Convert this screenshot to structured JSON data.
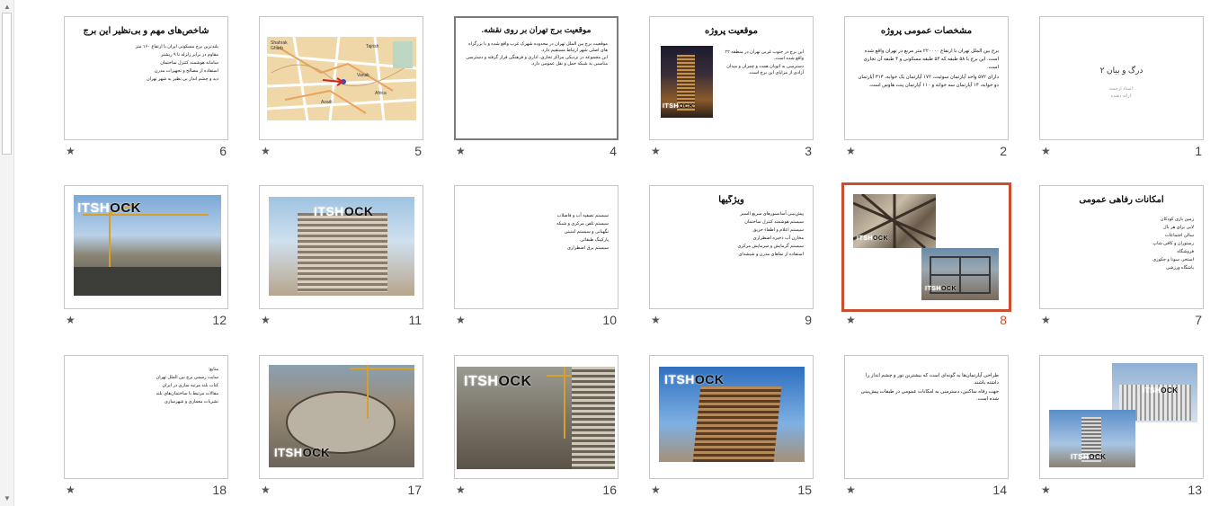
{
  "watermark": {
    "light": "ITSH",
    "dark": "OCK"
  },
  "star_icon": "★",
  "slides": [
    {
      "number": "1",
      "title": "درگ و بیان ۲",
      "subtitle": "استاد ارجمند:",
      "subtitle2": "ارائه دهنده:"
    },
    {
      "number": "2",
      "title": "مشخصات عمومی پروژه",
      "bullets": [
        "برج بین الملل تهران با ارتفاع ۲۲۰۰۰۰ متر مربع در تهران واقع شده است. این برج با ۵۸ طبقه که ۵۴ طبقه مسکونی و ۴ طبقه آن تجاری است.",
        "دارای ۵۷۲ واحد آپارتمان سوئیت، ۱۷۲ آپارتمان یک خوابه، ۳۱۳ آپارتمان دو خوابه، ۱۴ آپارتمان سه خوابه و ۱۱۰ آپارتمان پنت هاوس است."
      ]
    },
    {
      "number": "3",
      "title": "موقعیت پروژه",
      "bullets": [
        "این برج در جنوب غربی تهران در منطقه ۲۲ واقع شده است.",
        "دسترسی به اتوبان همت و چمران و میدان آزادی از مزایای این برج است."
      ]
    },
    {
      "number": "4",
      "title": "موقعیت برج تهران بر روی نقشه.",
      "bullets": [
        "موقعیت برج بین الملل تهران در محدوده شهرک غرب واقع شده و با بزرگراه های اصلی شهر ارتباط مستقیم دارد.",
        "این مجموعه در نزدیکی مراکز تجاری، اداری و فرهنگی قرار گرفته و دسترسی مناسبی به شبکه حمل و نقل عمومی دارد."
      ]
    },
    {
      "number": "5",
      "map_labels": [
        "Shahrak",
        "Gharb",
        "Azadi",
        "Africa",
        "Tajrish",
        "Vanak"
      ]
    },
    {
      "number": "6",
      "title": "شاخص‌های مهم و بی‌نظیر این برج",
      "bullets": [
        "بلندترین برج مسکونی ایران با ارتفاع ۱۶۰ متر",
        "مقاوم در برابر زلزله تا ۹ ریشتر",
        "سامانه هوشمند کنترل ساختمان",
        "استفاده از مصالح و تجهیزات مدرن",
        "دید و چشم انداز بی نظیر به شهر تهران"
      ]
    },
    {
      "number": "7",
      "title": "امکانات رفاهی عمومی",
      "bullets": [
        "زمین بازی کودکان",
        "لابی برای هر بال",
        "سالن اجتماعات",
        "رستوران و کافی شاپ",
        "فروشگاه",
        "استخر، سونا و جکوزی",
        "باشگاه ورزشی"
      ]
    },
    {
      "number": "8",
      "selected": true
    },
    {
      "number": "9",
      "title": "ویژگیها",
      "bullets": [
        "پیش‌بینی آسانسورهای سریع السیر",
        "سیستم هوشمند کنترل ساختمان",
        "سیستم اعلام و اطفاء حریق",
        "مخازن آب ذخیره اضطراری",
        "سیستم گرمایش و سرمایش مرکزی",
        "استفاده از نماهای مدرن و شیشه‌ای"
      ]
    },
    {
      "number": "10",
      "bullets": [
        "سیستم تصفیه آب و فاضلاب",
        "سیستم تلفن مرکزی و شبکه",
        "نگهبانی و سیستم امنیتی",
        "پارکینگ طبقاتی",
        "سیستم برق اضطراری"
      ]
    },
    {
      "number": "11"
    },
    {
      "number": "12"
    },
    {
      "number": "13"
    },
    {
      "number": "14",
      "bullets": [
        "طراحی آپارتمان‌ها به گونه‌ای است که بیشترین نور و چشم انداز را داشته باشند.",
        "جهت رفاه ساکنین، دسترسی به امکانات عمومی در طبقات پیش‌بینی شده است."
      ]
    },
    {
      "number": "15"
    },
    {
      "number": "16"
    },
    {
      "number": "17"
    },
    {
      "number": "18",
      "bullets": [
        "منابع:",
        "سایت رسمی برج بین الملل تهران",
        "کتاب بلند مرتبه سازی در ایران",
        "مقالات مرتبط با ساختمان‌های بلند",
        "نشریات معماری و شهرسازی"
      ]
    }
  ],
  "colors": {
    "accent": "#c8502e",
    "border": "#c6c6c6"
  }
}
